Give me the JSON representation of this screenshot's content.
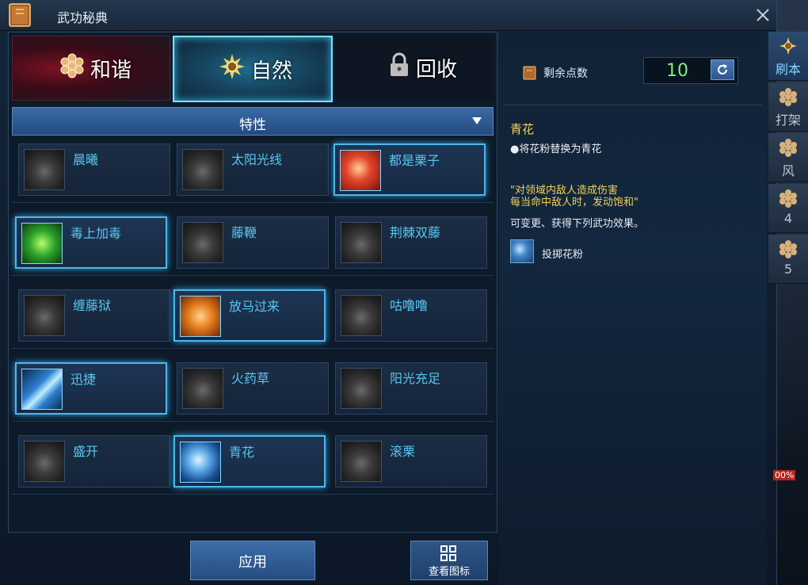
{
  "window": {
    "title": "武功秘典"
  },
  "tabs": [
    {
      "label": "和谐",
      "icon": "flower-icon"
    },
    {
      "label": "自然",
      "icon": "sun-flower-icon"
    },
    {
      "label": "回收",
      "icon": "lock-icon"
    }
  ],
  "trait_dropdown": {
    "label": "特性"
  },
  "skills": [
    {
      "name": "晨曦"
    },
    {
      "name": "太阳光线"
    },
    {
      "name": "都是栗子"
    },
    {
      "name": "毒上加毒"
    },
    {
      "name": "藤鞭"
    },
    {
      "name": "荆棘双藤"
    },
    {
      "name": "缠藤狱"
    },
    {
      "name": "放马过来"
    },
    {
      "name": "咕噜噜"
    },
    {
      "name": "迅捷"
    },
    {
      "name": "火药草"
    },
    {
      "name": "阳光充足"
    },
    {
      "name": "盛开"
    },
    {
      "name": "青花"
    },
    {
      "name": "滚栗"
    }
  ],
  "buttons": {
    "apply": "应用",
    "view_icons": "查看图标"
  },
  "points": {
    "label": "剩余点数",
    "value": "10"
  },
  "info": {
    "title": "青花",
    "desc": "●将花粉替换为青花",
    "quote_line1": "\"对领域内敌人造成伤害",
    "quote_line2": "每当命中敌人时，发动饱和\"",
    "note": "可变更、获得下列武功效果。",
    "effect": "投掷花粉"
  },
  "side_tabs": [
    {
      "label": "刷本"
    },
    {
      "label": "打架"
    },
    {
      "label": "风"
    },
    {
      "label": "4"
    },
    {
      "label": "5"
    }
  ],
  "hud": {
    "hp_fragment": "00%"
  },
  "colors": {
    "accent": "#4fb6ea",
    "highlight_text": "#f0d25a",
    "points": "#7ff07a"
  }
}
